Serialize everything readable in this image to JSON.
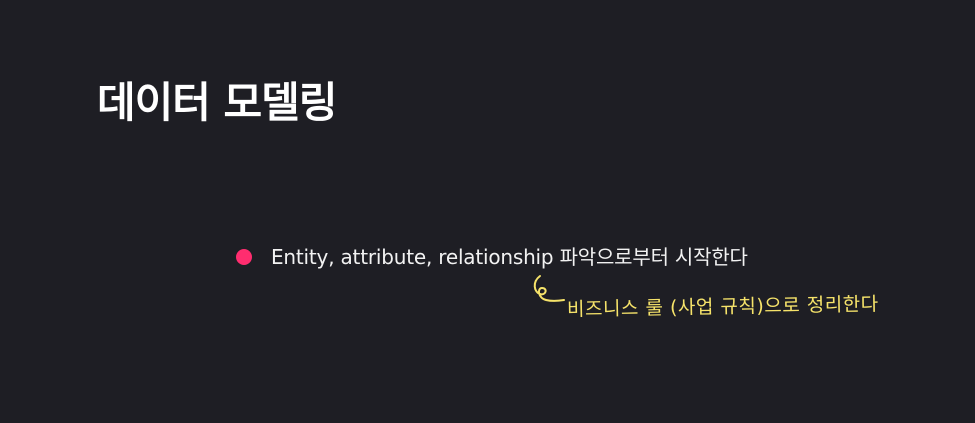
{
  "slide": {
    "title": "데이터 모델링",
    "bullet": {
      "text": "Entity, attribute, relationship 파악으로부터 시작한다",
      "dot_color": "#ff2d6f"
    },
    "annotation": {
      "text": "비즈니스 룰 (사업 규칙)으로 정리한다",
      "color": "#f6e36a",
      "icon": "curly-arrow-icon"
    },
    "background_color": "#1e1e24"
  }
}
